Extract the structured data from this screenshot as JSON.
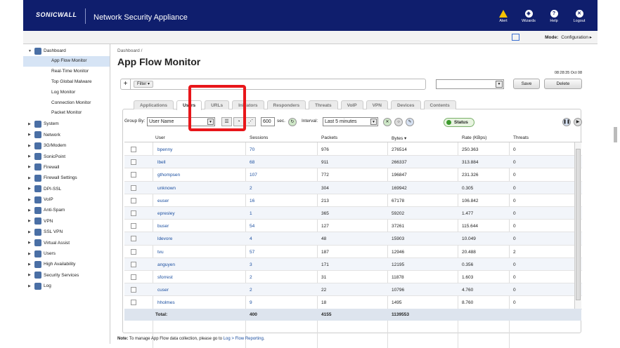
{
  "header": {
    "logo": "SONICWALL",
    "app_title": "Network Security Appliance",
    "icons": [
      {
        "name": "alert-icon",
        "label": "Alert"
      },
      {
        "name": "wizards-icon",
        "label": "Wizards"
      },
      {
        "name": "help-icon",
        "label": "Help"
      },
      {
        "name": "logout-icon",
        "label": "Logout"
      }
    ]
  },
  "modebar": {
    "mode_label": "Mode:",
    "mode_value": "Configuration ▸"
  },
  "sidebar": {
    "dashboard": {
      "label": "Dashboard",
      "items": [
        "App Flow Monitor",
        "Real-Time Monitor",
        "Top Global Malware",
        "Log Monitor",
        "Connection Monitor",
        "Packet Monitor"
      ]
    },
    "sections": [
      "System",
      "Network",
      "3G/Modem",
      "SonicPoint",
      "Firewall",
      "Firewall Settings",
      "DPI-SSL",
      "VoIP",
      "Anti-Spam",
      "VPN",
      "SSL VPN",
      "Virtual Assist",
      "Users",
      "High Availability",
      "Security Services",
      "Log"
    ]
  },
  "page": {
    "breadcrumb": "Dashboard /",
    "title": "App Flow Monitor",
    "timestamp": "08:28:35 Oct 08"
  },
  "filter": {
    "plus": "+",
    "button": "Filter ▾",
    "save": "Save",
    "delete": "Delete"
  },
  "tabs": [
    "Applications",
    "Users",
    "URLs",
    "Initiators",
    "Responders",
    "Threats",
    "VoIP",
    "VPN",
    "Devices",
    "Contents"
  ],
  "controls": {
    "group_by_label": "Group By:",
    "group_by_value": "User Name",
    "refresh_value": "600",
    "sec_label": "sec.",
    "interval_label": "Interval:",
    "interval_value": "Last 5 minutes",
    "status_label": "Status"
  },
  "table": {
    "headers": [
      "User",
      "Sessions",
      "Packets",
      "Bytes ▾",
      "Rate (KBps)",
      "Threats"
    ],
    "rows": [
      [
        "bpenny",
        "70",
        "976",
        "276514",
        "250.363",
        "0"
      ],
      [
        "lbell",
        "68",
        "911",
        "266337",
        "313.884",
        "0"
      ],
      [
        "gthompsen",
        "107",
        "772",
        "196847",
        "231.326",
        "0"
      ],
      [
        "unknown",
        "2",
        "304",
        "169942",
        "0.305",
        "0"
      ],
      [
        "euser",
        "16",
        "213",
        "67178",
        "106.842",
        "0"
      ],
      [
        "epresley",
        "1",
        "365",
        "59202",
        "1.477",
        "0"
      ],
      [
        "buser",
        "54",
        "127",
        "37261",
        "115.644",
        "0"
      ],
      [
        "ldevore",
        "4",
        "48",
        "15903",
        "10.049",
        "0"
      ],
      [
        "tvu",
        "57",
        "187",
        "12946",
        "20.488",
        "2"
      ],
      [
        "anguyen",
        "3",
        "171",
        "12195",
        "0.356",
        "0"
      ],
      [
        "sforrest",
        "2",
        "31",
        "11878",
        "1.603",
        "0"
      ],
      [
        "cuser",
        "2",
        "22",
        "10796",
        "4.760",
        "0"
      ],
      [
        "hholmes",
        "9",
        "18",
        "1495",
        "8.760",
        "0"
      ]
    ],
    "total": {
      "label": "Total:",
      "sessions": "400",
      "packets": "4155",
      "bytes": "1139553"
    }
  },
  "note": {
    "bold": "Note:",
    "text": " To manage App Flow data collection, please go to ",
    "link": "Log > Flow Reporting",
    "end": "."
  },
  "colors": {
    "header_bg": "#0f1e6d",
    "highlight": "#e8161a",
    "link": "#1b4fa0"
  }
}
